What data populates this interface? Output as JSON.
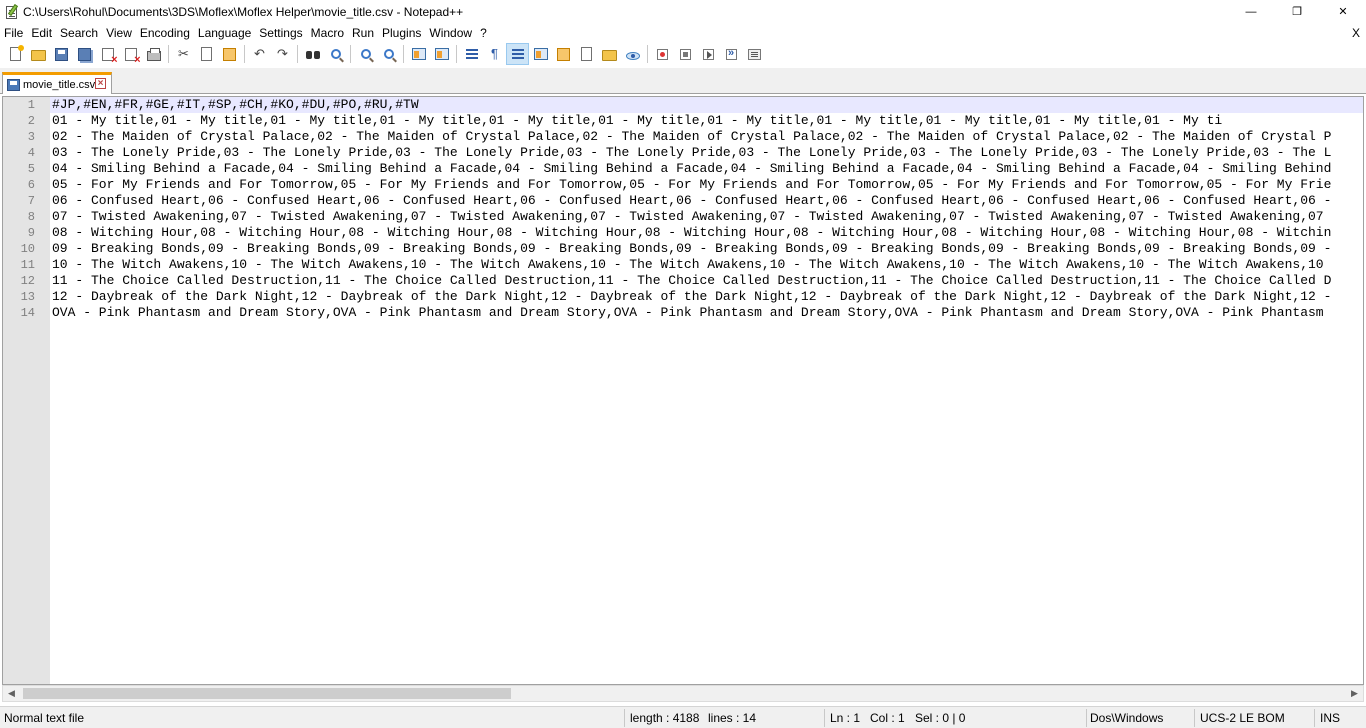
{
  "window": {
    "title": "C:\\Users\\Rohul\\Documents\\3DS\\Moflex\\Moflex Helper\\movie_title.csv - Notepad++",
    "minimize_glyph": "—",
    "restore_glyph": "❐",
    "close_glyph": "✕"
  },
  "menu": {
    "items": [
      "File",
      "Edit",
      "Search",
      "View",
      "Encoding",
      "Language",
      "Settings",
      "Macro",
      "Run",
      "Plugins",
      "Window",
      "?"
    ],
    "close_doc": "X"
  },
  "toolbar": {
    "icons": [
      "new-file-icon",
      "open-folder-icon",
      "save-icon",
      "save-all-icon",
      "close-icon",
      "close-all-icon",
      "print-icon",
      "cut-icon",
      "copy-icon",
      "paste-icon",
      "undo-icon",
      "redo-icon",
      "find-icon",
      "replace-icon",
      "zoom-in-icon",
      "zoom-out-icon",
      "sync-vertical-icon",
      "sync-horizontal-icon",
      "word-wrap-icon",
      "show-all-chars-icon",
      "indent-guide-icon",
      "user-defined-language-icon",
      "document-map-icon",
      "function-list-icon",
      "folder-as-workspace-icon",
      "monitoring-icon",
      "record-macro-icon",
      "stop-macro-icon",
      "play-macro-icon",
      "run-macro-multiple-icon",
      "save-macro-icon"
    ],
    "glyphs": {
      "cut": "✂",
      "undo": "↶",
      "redo": "↷",
      "show_all": "¶"
    },
    "active_button": "indent-guide-icon"
  },
  "tabs": [
    {
      "label": "movie_title.csv",
      "close_glyph": "×"
    }
  ],
  "editor": {
    "current_line": 1,
    "lines": [
      {
        "num": "1",
        "text": "#JP,#EN,#FR,#GE,#IT,#SP,#CH,#KO,#DU,#PO,#RU,#TW"
      },
      {
        "num": "2",
        "text": "01 - My title,01 - My title,01 - My title,01 - My title,01 - My title,01 - My title,01 - My title,01 - My title,01 - My title,01 - My title,01 - My ti"
      },
      {
        "num": "3",
        "text": "02 - The Maiden of Crystal Palace,02 - The Maiden of Crystal Palace,02 - The Maiden of Crystal Palace,02 - The Maiden of Crystal Palace,02 - The Maiden of Crystal P"
      },
      {
        "num": "4",
        "text": "03 - The Lonely Pride,03 - The Lonely Pride,03 - The Lonely Pride,03 - The Lonely Pride,03 - The Lonely Pride,03 - The Lonely Pride,03 - The Lonely Pride,03 - The L"
      },
      {
        "num": "5",
        "text": "04 - Smiling Behind a Facade,04 - Smiling Behind a Facade,04 - Smiling Behind a Facade,04 - Smiling Behind a Facade,04 - Smiling Behind a Facade,04 - Smiling Behind"
      },
      {
        "num": "6",
        "text": "05 - For My Friends and For Tomorrow,05 - For My Friends and For Tomorrow,05 - For My Friends and For Tomorrow,05 - For My Friends and For Tomorrow,05 - For My Frie"
      },
      {
        "num": "7",
        "text": "06 - Confused Heart,06 - Confused Heart,06 - Confused Heart,06 - Confused Heart,06 - Confused Heart,06 - Confused Heart,06 - Confused Heart,06 - Confused Heart,06 -"
      },
      {
        "num": "8",
        "text": "07 - Twisted Awakening,07 - Twisted Awakening,07 - Twisted Awakening,07 - Twisted Awakening,07 - Twisted Awakening,07 - Twisted Awakening,07 - Twisted Awakening,07"
      },
      {
        "num": "9",
        "text": "08 - Witching Hour,08 - Witching Hour,08 - Witching Hour,08 - Witching Hour,08 - Witching Hour,08 - Witching Hour,08 - Witching Hour,08 - Witching Hour,08 - Witchin"
      },
      {
        "num": "10",
        "text": "09 - Breaking Bonds,09 - Breaking Bonds,09 - Breaking Bonds,09 - Breaking Bonds,09 - Breaking Bonds,09 - Breaking Bonds,09 - Breaking Bonds,09 - Breaking Bonds,09 -"
      },
      {
        "num": "11",
        "text": "10 - The Witch Awakens,10 - The Witch Awakens,10 - The Witch Awakens,10 - The Witch Awakens,10 - The Witch Awakens,10 - The Witch Awakens,10 - The Witch Awakens,10"
      },
      {
        "num": "12",
        "text": "11 - The Choice Called Destruction,11 - The Choice Called Destruction,11 - The Choice Called Destruction,11 - The Choice Called Destruction,11 - The Choice Called D"
      },
      {
        "num": "13",
        "text": "12 - Daybreak of the Dark Night,12 - Daybreak of the Dark Night,12 - Daybreak of the Dark Night,12 - Daybreak of the Dark Night,12 - Daybreak of the Dark Night,12 -"
      },
      {
        "num": "14",
        "text": "OVA - Pink Phantasm and Dream Story,OVA - Pink Phantasm and Dream Story,OVA - Pink Phantasm and Dream Story,OVA - Pink Phantasm and Dream Story,OVA - Pink Phantasm"
      }
    ]
  },
  "scrollbar": {
    "left_arrow": "◀",
    "right_arrow": "▶"
  },
  "statusbar": {
    "file_type": "Normal text file",
    "length": "length : 4188",
    "lines": "lines : 14",
    "ln": "Ln : 1",
    "col": "Col : 1",
    "sel": "Sel : 0 | 0",
    "eol": "Dos\\Windows",
    "encoding": "UCS-2 LE BOM",
    "mode": "INS"
  },
  "colors": {
    "active_tab_accent": "#f39c00",
    "current_line_bg": "#e8e8ff",
    "gutter_bg": "#e4e4e4",
    "line_number_fg": "#808080"
  }
}
